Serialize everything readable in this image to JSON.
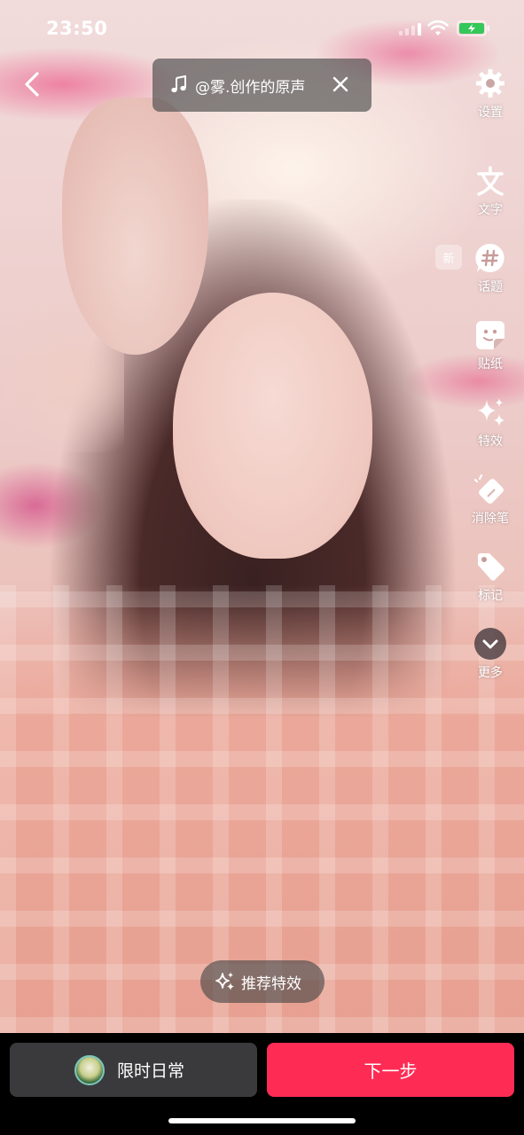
{
  "status_bar": {
    "time": "23:50"
  },
  "header": {
    "music_label": "@雾.创作的原声"
  },
  "toolbar": {
    "items": [
      {
        "label": "设置",
        "icon": "gear-icon"
      },
      {
        "label": "文字",
        "icon": "text-icon"
      },
      {
        "label": "话题",
        "icon": "hashtag-icon"
      },
      {
        "label": "贴纸",
        "icon": "sticker-icon"
      },
      {
        "label": "特效",
        "icon": "sparkle-icon"
      },
      {
        "label": "消除笔",
        "icon": "eraser-icon"
      },
      {
        "label": "标记",
        "icon": "tag-icon"
      },
      {
        "label": "更多",
        "icon": "chevron-down-icon"
      }
    ],
    "new_badge": "新"
  },
  "recommend_effects": {
    "label": "推荐特效"
  },
  "footer": {
    "daily_label": "限时日常",
    "next_label": "下一步"
  },
  "colors": {
    "accent": "#fe2c55",
    "secondary_button": "#3a3a3c"
  }
}
